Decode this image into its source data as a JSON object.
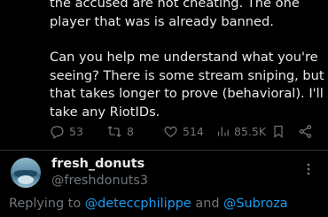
{
  "tweet": {
    "text_lines": [
      "the accused are not cheating.  The one player that was is already banned.",
      "Can you help me understand what you're seeing? There is some stream sniping, but that takes longer to prove (behavioral).  I'll take any RiotIDs."
    ],
    "actions": {
      "replies": "53",
      "retweets": "8",
      "likes": "514",
      "views": "85.5K"
    },
    "icons": [
      "reply-icon",
      "retweet-icon",
      "like-icon",
      "views-icon",
      "bookmark-icon",
      "share-icon"
    ]
  },
  "reply_author": {
    "display_name": "fresh_donuts",
    "handle": "@freshdonuts3"
  },
  "replying_to": {
    "prefix": "Replying to",
    "user1": "@deteccphilippe",
    "conjunction": "and",
    "user2": "@Subroza"
  },
  "colors": {
    "background": "#000000",
    "text": "#e7e9ea",
    "muted": "#71767b",
    "link": "#1d9bf0",
    "divider": "#2f3336"
  }
}
